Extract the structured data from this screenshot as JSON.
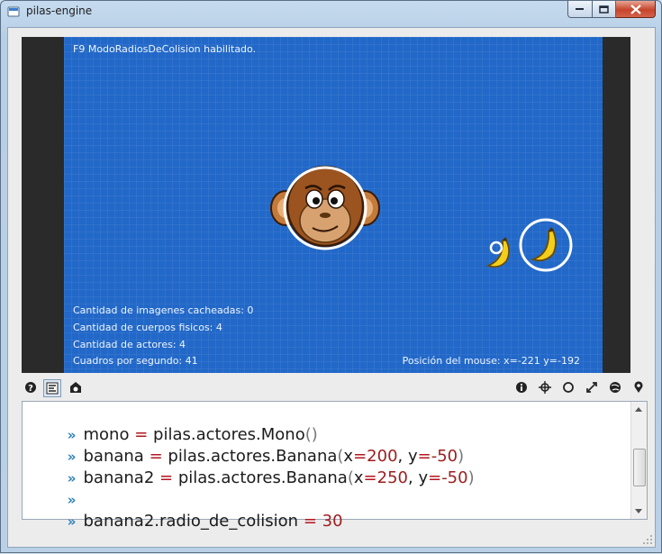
{
  "window": {
    "title": "pilas-engine"
  },
  "stage": {
    "message": "F9 ModoRadiosDeColision habilitado.",
    "stats": [
      "Cantidad de imagenes cacheadas: 0",
      "Cantidad de cuerpos fisicos: 4",
      "Cantidad de actores: 4",
      "Cuadros por segundo: 41"
    ],
    "mouse_position": "Posición del mouse: x=-221 y=-192"
  },
  "toolbar": {
    "left_icons": [
      "help-icon",
      "editor-icon",
      "screenshot-icon"
    ],
    "right_icons": [
      "info-icon",
      "position-icon",
      "radius-icon",
      "fullscreen-icon",
      "physics-icon",
      "marker-icon"
    ]
  },
  "console": {
    "prompt": "»",
    "lines": [
      {
        "target": "mono",
        "op": "=",
        "call": "pilas.actores.Mono",
        "args": []
      },
      {
        "target": "banana",
        "op": "=",
        "call": "pilas.actores.Banana",
        "args": [
          {
            "name": "x",
            "eq": "=",
            "value": "200"
          },
          {
            "name": "y",
            "eq": "=",
            "value": "-50"
          }
        ]
      },
      {
        "target": "banana2",
        "op": "=",
        "call": "pilas.actores.Banana",
        "args": [
          {
            "name": "x",
            "eq": "=",
            "value": "250"
          },
          {
            "name": "y",
            "eq": "=",
            "value": "-50"
          }
        ]
      },
      {
        "empty": true
      },
      {
        "target": "banana2.radio_de_colision",
        "op": "=",
        "value": "30"
      }
    ]
  },
  "colors": {
    "stage_background": "#2268c8",
    "operator": "#b3151d",
    "prompt": "#2c7fb8"
  }
}
